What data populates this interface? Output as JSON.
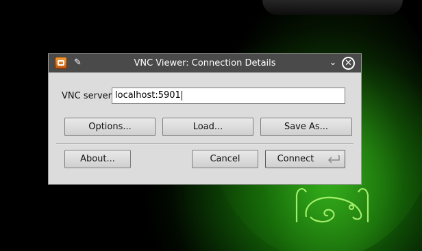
{
  "window": {
    "title": "VNC Viewer: Connection Details"
  },
  "form": {
    "server_label": "VNC server:",
    "server_value": "localhost:5901"
  },
  "buttons": {
    "options": "Options...",
    "load": "Load...",
    "save_as": "Save As...",
    "about": "About...",
    "cancel": "Cancel",
    "connect": "Connect"
  },
  "icons": {
    "app": "vnc-app-icon",
    "pin": "pin-icon",
    "minimize": "chevron-down-icon",
    "close": "close-icon",
    "connect": "enter-arrow-icon"
  },
  "colors": {
    "titlebar": "#4a4a4a",
    "dialog_bg": "#dcdcdc",
    "wallpaper_glow": "#1f8a12"
  }
}
